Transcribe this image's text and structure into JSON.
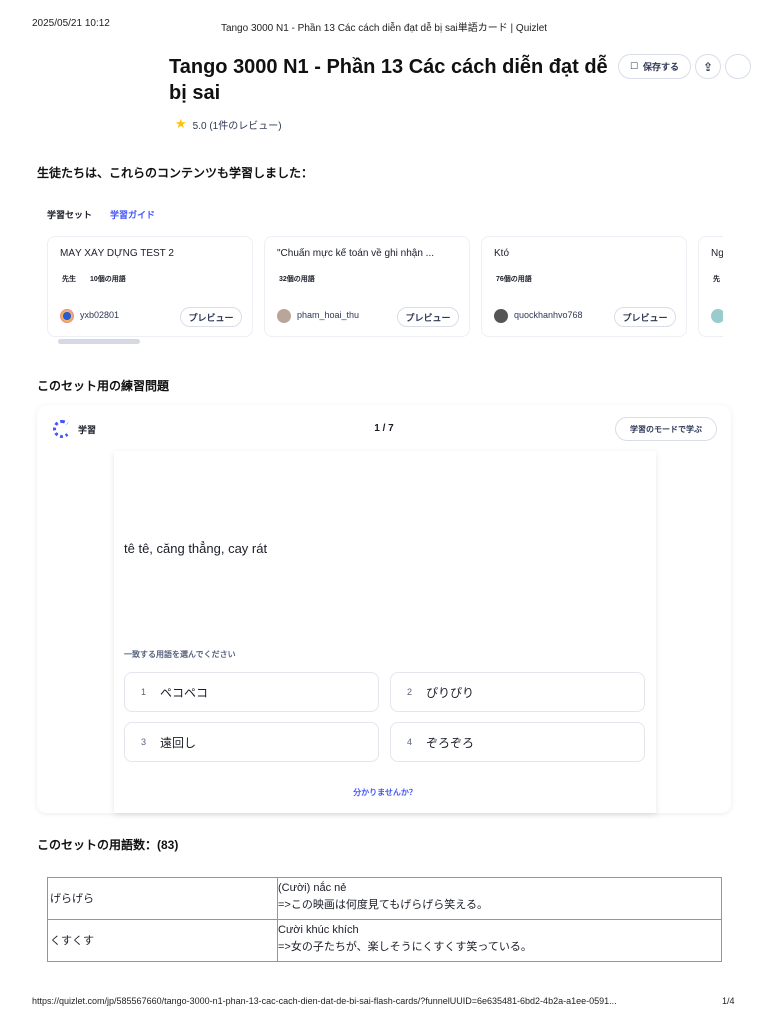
{
  "browser": {
    "timestamp": "2025/05/21 10:12",
    "page_title": "Tango 3000 N1 - Phần 13 Các cách diễn đạt dễ bị sai単語カード | Quizlet",
    "url": "https://quizlet.com/jp/585567660/tango-3000-n1-phan-13-cac-cach-dien-dat-de-bi-sai-flash-cards/?funnelUUID=6e635481-6bd2-4b2a-a1ee-0591...",
    "page_num": "1/4"
  },
  "header": {
    "title": "Tango 3000 N1 - Phần 13 Các cách diễn đạt dễ bị sai",
    "save_label": "保存する",
    "rating": "5.0 (1件のレビュー)"
  },
  "also_studied": {
    "heading": "生徒たちは、これらのコンテンツも学習しました：",
    "tabs": [
      "学習セット",
      "学習ガイド"
    ],
    "cards": [
      {
        "title": "MÁY XÂY DỰNG TEST 2",
        "badge": "先生",
        "terms": "10個の用語",
        "user": "yxb02801",
        "preview": "プレビュー"
      },
      {
        "title": "\"Chuẩn mực kế toán về ghi nhận ...",
        "badge": "",
        "terms": "32個の用語",
        "user": "pham_hoai_thu",
        "preview": "プレビュー"
      },
      {
        "title": "Któ",
        "badge": "",
        "terms": "76個の用語",
        "user": "quockhanhvo768",
        "preview": "プレビュー"
      },
      {
        "title": "Ng",
        "badge": "先",
        "terms": "",
        "user": "",
        "preview": ""
      }
    ]
  },
  "practice": {
    "heading": "このセット用の練習問題",
    "mode": "学習",
    "progress": "1 / 7",
    "learn_button": "学習のモードで学ぶ",
    "prompt": "tê tê, căng thẳng, cay rát",
    "instruction": "一致する用語を選んでください",
    "options": [
      {
        "n": "1",
        "text": "ペコペコ"
      },
      {
        "n": "2",
        "text": "ぴりぴり"
      },
      {
        "n": "3",
        "text": "遠回し"
      },
      {
        "n": "4",
        "text": "ぞろぞろ"
      }
    ],
    "dont_know": "分かりませんか？"
  },
  "terms": {
    "heading": "このセットの用語数：(83)",
    "rows": [
      {
        "term": "げらげら",
        "def": "(Cười) nắc nẻ",
        "example": "=>この映画は何度見てもげらげら笑える。"
      },
      {
        "term": "くすくす",
        "def": "Cười khúc khích",
        "example": "=>女の子たちが、楽しそうにくすくす笑っている。"
      }
    ]
  }
}
